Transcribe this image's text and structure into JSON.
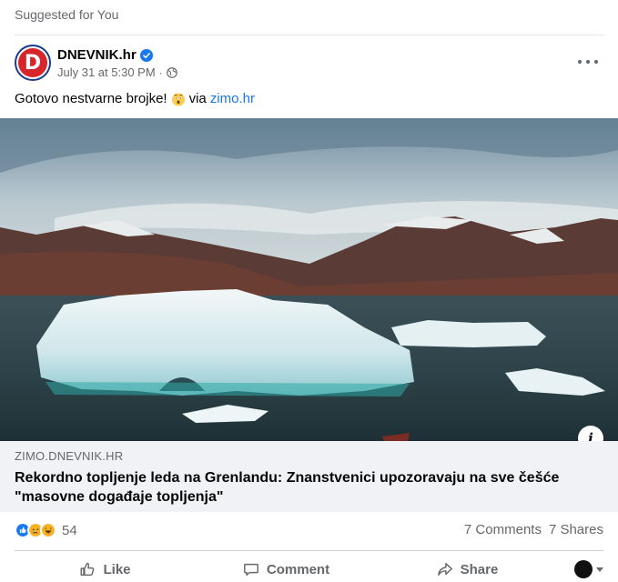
{
  "section_label": "Suggested for You",
  "post": {
    "page_name": "DNEVNIK.hr",
    "avatar_letter": "D",
    "timestamp": "July 31 at 5:30 PM",
    "separator": "·",
    "text_before": "Gotovo nestvarne brojke!",
    "text_via": "via",
    "link_text": "zimo.hr",
    "emoji": "astonished-face"
  },
  "link_preview": {
    "domain": "ZIMO.DNEVNIK.HR",
    "title": "Rekordno topljenje leda na Grenlandu: Znanstvenici upozoravaju na sve češće \"masovne događaje topljenja\"",
    "info_label": "i"
  },
  "stats": {
    "reaction_count": "54",
    "comments": "7 Comments",
    "shares": "7 Shares",
    "reactions": [
      "like",
      "sad",
      "haha"
    ]
  },
  "actions": {
    "like": "Like",
    "comment": "Comment",
    "share": "Share"
  },
  "colors": {
    "brand_blue": "#1877f2",
    "brand_red": "#d7262b"
  }
}
